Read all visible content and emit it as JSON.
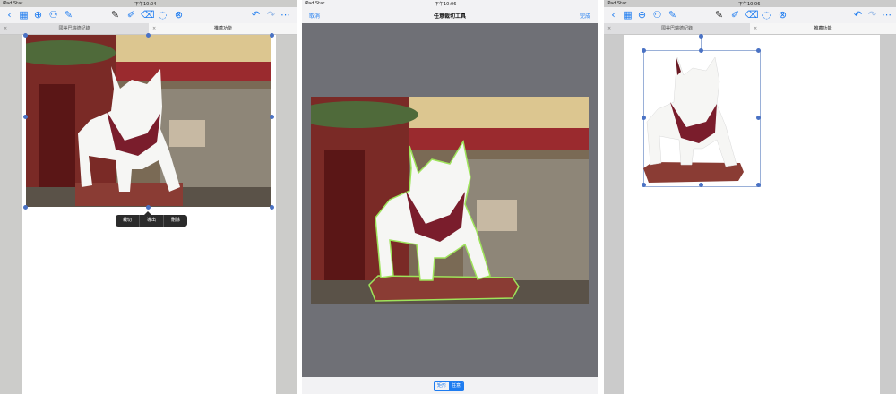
{
  "status": {
    "left": {
      "carrier": "iPad Star"
    },
    "middle": {
      "time": "下午10:04"
    },
    "right": {
      "time": "下午10:06"
    },
    "crop": {
      "carrier": "iPad Star",
      "time": "下午10:06"
    }
  },
  "toolbar": {
    "icons": [
      "back-chevron-icon",
      "grid-icon",
      "add-icon",
      "share-icon",
      "edit-icon",
      "pen-icon",
      "highlighter-icon",
      "eraser-icon",
      "lasso-icon",
      "close-icon",
      "undo-icon",
      "redo-icon",
      "more-icon"
    ],
    "accent": "#1e7cf0"
  },
  "tabs": {
    "left": {
      "inactive": "國美巴瑞德紀錄",
      "active": "推薦功能"
    },
    "right": {
      "inactive": "國美巴瑞德紀錄",
      "active": "推薦功能"
    }
  },
  "context_menu": {
    "items": [
      "裁切",
      "導出",
      "刪除"
    ]
  },
  "crop_tool": {
    "cancel": "取消",
    "title": "任意裁切工具",
    "done": "完成",
    "modes": [
      "矩形",
      "任意"
    ],
    "selected_mode": "任意",
    "outline_color": "#9ee35a"
  }
}
